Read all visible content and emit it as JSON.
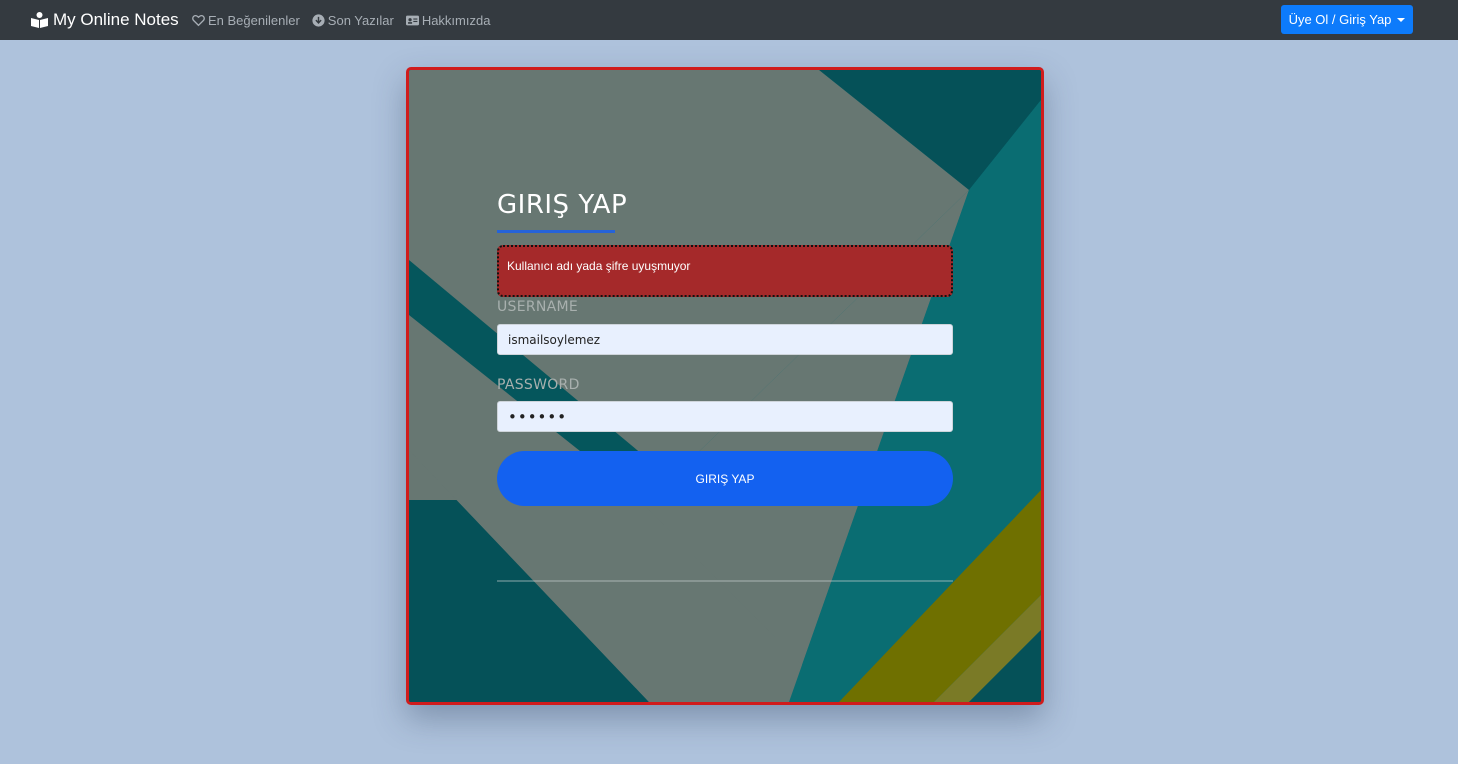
{
  "navbar": {
    "brand": "My Online Notes",
    "links": [
      {
        "label": "En Beğenilenler",
        "icon": "heart-icon"
      },
      {
        "label": "Son Yazılar",
        "icon": "arrow-circle-down-icon"
      },
      {
        "label": "Hakkımızda",
        "icon": "id-card-icon"
      }
    ],
    "account_button": "Üye Ol / Giriş Yap"
  },
  "login": {
    "title": "GIRIŞ YAP",
    "error_message": "Kullanıcı adı yada şifre uyuşmuyor",
    "username_label": "USERNAME",
    "username_value": "ismailsoylemez",
    "password_label": "PASSWORD",
    "password_value": "••••••",
    "submit_label": "GIRIŞ YAP"
  },
  "colors": {
    "page_bg": "#aec2dc",
    "navbar_bg": "#343a40",
    "accent_blue": "#1361f0",
    "error_bg": "#a5292a",
    "card_border": "#d01c1c"
  }
}
